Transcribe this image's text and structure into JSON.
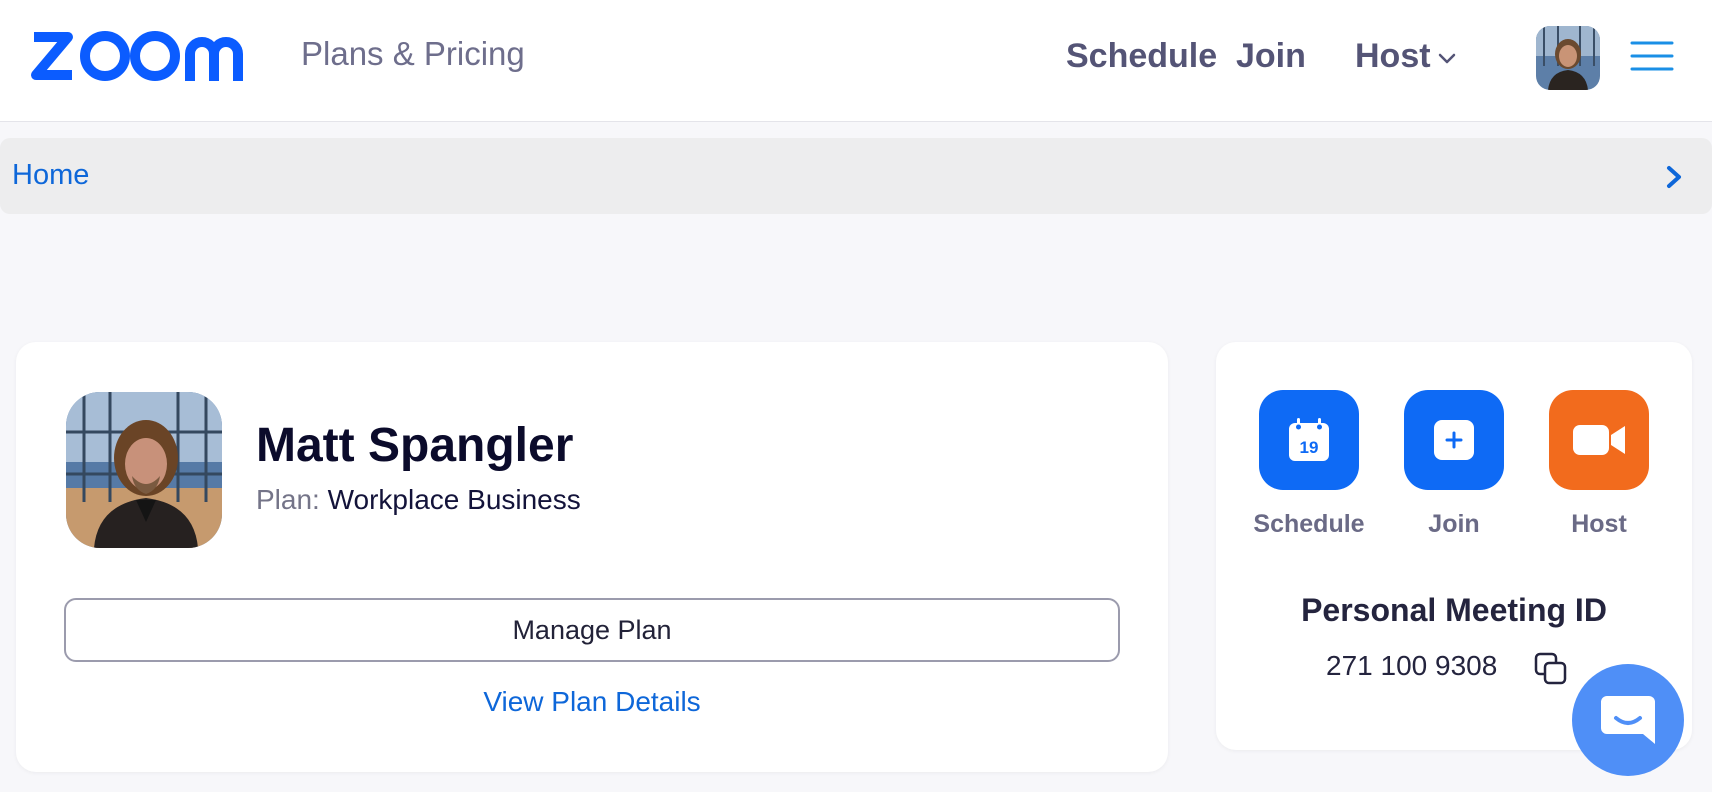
{
  "nav": {
    "logo_text": "zoom",
    "plans_pricing": "Plans & Pricing",
    "schedule": "Schedule",
    "join": "Join",
    "host": "Host",
    "brand_color": "#0b5cff"
  },
  "breadcrumb": {
    "home": "Home"
  },
  "profile": {
    "name": "Matt Spangler",
    "plan_label": "Plan:",
    "plan_value": "Workplace Business",
    "manage_plan": "Manage Plan",
    "view_plan_details": "View Plan Details"
  },
  "actions": {
    "schedule": {
      "label": "Schedule",
      "icon": "calendar-icon",
      "calendar_day": "19",
      "color": "#0e6af5"
    },
    "join": {
      "label": "Join",
      "icon": "plus-icon",
      "color": "#0e6af5"
    },
    "host": {
      "label": "Host",
      "icon": "video-camera-icon",
      "color": "#f26b1d"
    }
  },
  "meeting": {
    "title": "Personal Meeting ID",
    "id": "271 100 9308"
  },
  "chat": {
    "icon": "chat-icon",
    "color": "#4f8ff7"
  }
}
